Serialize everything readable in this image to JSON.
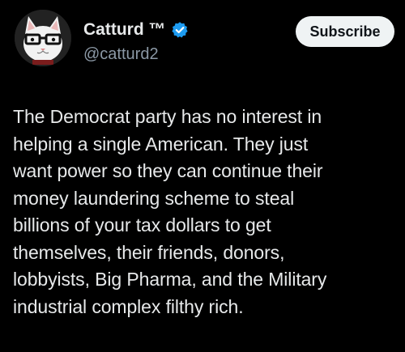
{
  "author": {
    "display_name": "Catturd ™",
    "handle": "@catturd2",
    "verified": true,
    "verified_color": "#1d9bf0"
  },
  "actions": {
    "subscribe_label": "Subscribe"
  },
  "post": {
    "text": "The Democrat party has no interest in\nhelping a single American. They just\nwant power so they can continue their\nmoney laundering scheme to steal\nbillions of your tax dollars to get\nthemselves, their friends, donors,\nlobbyists, Big Pharma, and the Military\nindustrial complex filthy rich."
  },
  "icons": {
    "verified": "verified-badge-icon",
    "avatar": "cat-with-glasses-avatar"
  },
  "colors": {
    "background": "#000000",
    "text": "#e7e9ea",
    "secondary_text": "#8b98a5",
    "button_bg": "#eff3f4",
    "button_text": "#0f1419"
  }
}
